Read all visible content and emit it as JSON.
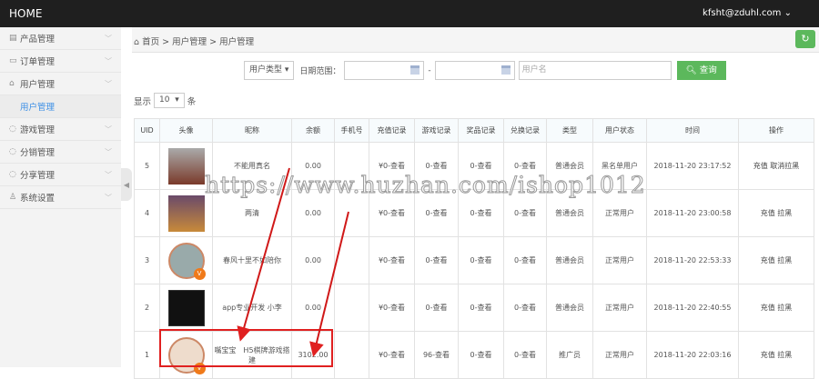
{
  "header": {
    "title": "HOME",
    "user": "kfsht@zduhl.com"
  },
  "sidebar": {
    "items": [
      {
        "label": "产品管理",
        "icon": "product-icon"
      },
      {
        "label": "订单管理",
        "icon": "order-icon"
      },
      {
        "label": "用户管理",
        "icon": "user-icon"
      },
      {
        "label": "用户管理",
        "sub": true
      },
      {
        "label": "游戏管理",
        "icon": "chat-icon"
      },
      {
        "label": "分销管理",
        "icon": "chat-icon"
      },
      {
        "label": "分享管理",
        "icon": "chat-icon"
      },
      {
        "label": "系统设置",
        "icon": "settings-icon"
      }
    ]
  },
  "breadcrumb": [
    "首页",
    ">",
    "用户管理",
    ">",
    "用户管理"
  ],
  "filters": {
    "user_type": "用户类型",
    "date_label": "日期范围：",
    "dash": "-",
    "username_placeholder": "用户名",
    "search": "查询"
  },
  "page_size": {
    "prefix": "显示",
    "value": "10",
    "suffix": "条"
  },
  "table": {
    "headers": [
      "UID",
      "头像",
      "昵称",
      "余额",
      "手机号",
      "充值记录",
      "游戏记录",
      "奖品记录",
      "兑换记录",
      "类型",
      "用户状态",
      "时间",
      "操作"
    ],
    "rows": [
      [
        "5",
        "",
        "不能用真名",
        "0.00",
        "",
        "¥0-查看",
        "0-查看",
        "0-查看",
        "0-查看",
        "普通会员",
        "黑名单用户",
        "2018-11-20 23:17:52",
        "充值  取消拉黑"
      ],
      [
        "4",
        "",
        "两清",
        "0.00",
        "",
        "¥0-查看",
        "0-查看",
        "0-查看",
        "0-查看",
        "普通会员",
        "正常用户",
        "2018-11-20 23:00:58",
        "充值  拉黑"
      ],
      [
        "3",
        "",
        "春风十里不如陪你",
        "0.00",
        "",
        "¥0-查看",
        "0-查看",
        "0-查看",
        "0-查看",
        "普通会员",
        "正常用户",
        "2018-11-20 22:53:33",
        "充值  拉黑"
      ],
      [
        "2",
        "",
        "app专业开发 小李",
        "0.00",
        "",
        "¥0-查看",
        "0-查看",
        "0-查看",
        "0-查看",
        "普通会员",
        "正常用户",
        "2018-11-20 22:40:55",
        "充值  拉黑"
      ],
      [
        "1",
        "",
        "嘴宝宝　H5棋牌游戏搭建",
        "3102.00",
        "",
        "¥0-查看",
        "96-查看",
        "0-查看",
        "0-查看",
        "推广员",
        "正常用户",
        "2018-11-20 22:03:16",
        "充值  拉黑"
      ]
    ]
  },
  "watermark": "https://www.huzhan.com/ishop1012",
  "colors": {
    "topbar": "#1f1f1f",
    "green": "#5cb85c",
    "link": "#3a8ee6",
    "highlight": "#e02020"
  }
}
